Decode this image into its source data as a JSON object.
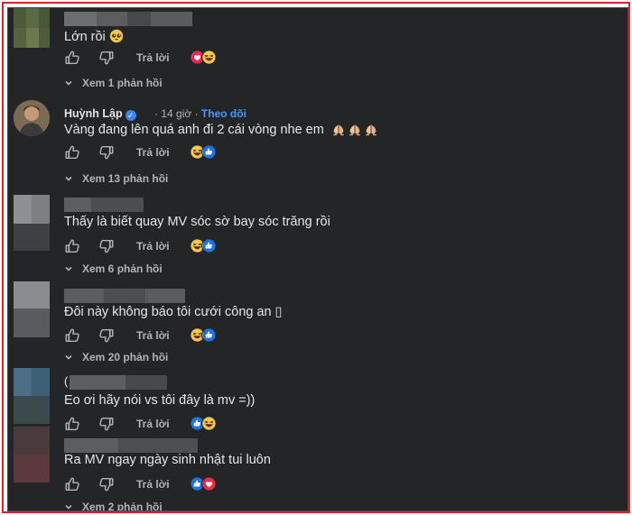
{
  "labels": {
    "like": "Thích",
    "dislike": "Không thích",
    "reply": "Trả lời"
  },
  "comments": [
    {
      "author": "",
      "time": "",
      "follow": "",
      "text": "Lớn rồi",
      "text_emoji": "pleading-face",
      "reactions": [
        "love",
        "haha"
      ],
      "replies": "Xem 1 phản hồi"
    },
    {
      "author": "Huỳnh Lập",
      "verified": true,
      "time": "14 giờ",
      "follow": "Theo dõi",
      "text": "Vàng đang lên quá anh đi 2 cái vòng nhe em",
      "text_emoji": "folded-hands x3",
      "reactions": [
        "haha",
        "like"
      ],
      "replies": "Xem 13 phản hồi"
    },
    {
      "author": "",
      "text": "Thấy là biết quay MV sóc sờ bay sóc trăng rồi",
      "reactions": [
        "haha",
        "like"
      ],
      "replies": "Xem 6 phản hồi"
    },
    {
      "author": "",
      "text": "Đôi này không báo tôi cưới công an ",
      "text_tail": "▯",
      "reactions": [
        "haha",
        "like"
      ],
      "replies": "Xem 20 phản hồi"
    },
    {
      "author": "",
      "prefix": "(",
      "text": "Eo ơi hãy nói vs tôi đây là mv =))",
      "reactions": [
        "like",
        "haha"
      ],
      "replies": ""
    },
    {
      "author": "",
      "text": "Ra MV ngay ngày sinh nhật tui luôn",
      "reactions": [
        "like",
        "love"
      ],
      "replies": "Xem 2 phản hồi"
    }
  ],
  "colors": {
    "panel_bg": "#242526",
    "text": "#e4e6eb",
    "secondary": "#b0b3b8",
    "link": "#4599ff",
    "frame": "#d8232a"
  }
}
